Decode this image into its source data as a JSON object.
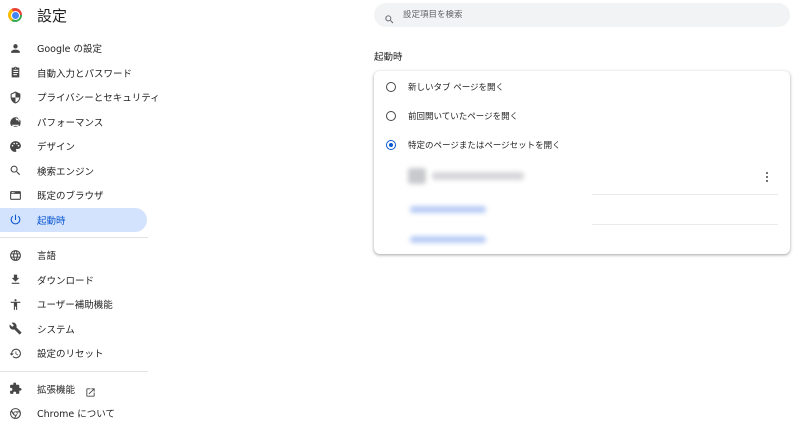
{
  "app": {
    "title": "設定"
  },
  "search": {
    "placeholder": "設定項目を検索"
  },
  "sidebar": {
    "items": [
      {
        "label": "Google の設定",
        "icon": "person-icon"
      },
      {
        "label": "自動入力とパスワード",
        "icon": "clipboard-icon"
      },
      {
        "label": "プライバシーとセキュリティ",
        "icon": "shield-icon"
      },
      {
        "label": "パフォーマンス",
        "icon": "speedometer-icon"
      },
      {
        "label": "デザイン",
        "icon": "palette-icon"
      },
      {
        "label": "検索エンジン",
        "icon": "search-icon"
      },
      {
        "label": "既定のブラウザ",
        "icon": "browser-icon"
      },
      {
        "label": "起動時",
        "icon": "power-icon",
        "active": true
      },
      {
        "label": "言語",
        "icon": "globe-icon"
      },
      {
        "label": "ダウンロード",
        "icon": "download-icon"
      },
      {
        "label": "ユーザー補助機能",
        "icon": "accessibility-icon"
      },
      {
        "label": "システム",
        "icon": "wrench-icon"
      },
      {
        "label": "設定のリセット",
        "icon": "restore-icon"
      },
      {
        "label": "拡張機能",
        "icon": "puzzle-icon"
      },
      {
        "label": "Chrome について",
        "icon": "chrome-icon"
      }
    ]
  },
  "main": {
    "section_title": "起動時",
    "options": [
      {
        "label": "新しいタブ ページを開く",
        "checked": false
      },
      {
        "label": "前回開いていたページを開く",
        "checked": false
      },
      {
        "label": "特定のページまたはページセットを開く",
        "checked": true
      }
    ]
  },
  "colors": {
    "accent": "#0b57d0",
    "active_bg": "#d3e3fd"
  }
}
